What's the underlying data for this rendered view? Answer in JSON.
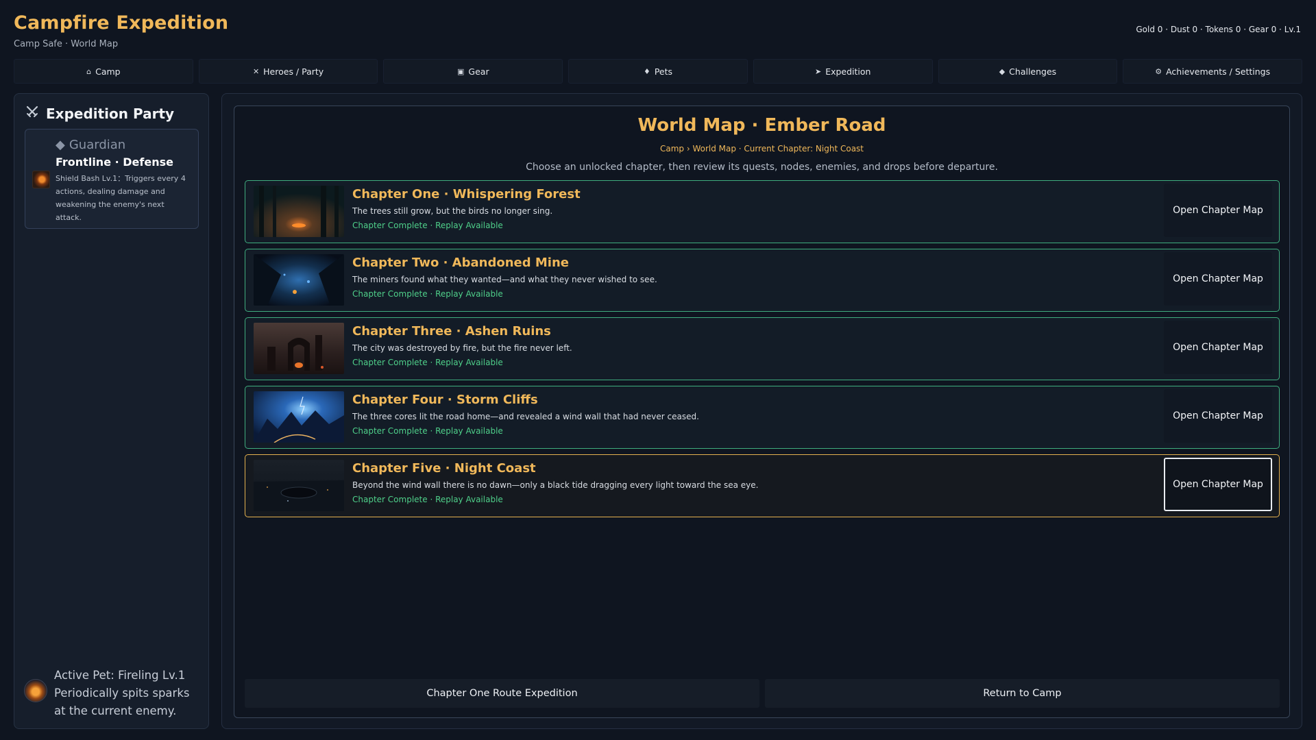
{
  "app": {
    "title": "Campfire Expedition",
    "subtitle": "Camp Safe · World Map",
    "resources": "Gold 0 · Dust 0 · Tokens 0 · Gear 0 · Lv.1"
  },
  "nav": {
    "tabs": [
      {
        "icon": "⌂",
        "label": "Camp"
      },
      {
        "icon": "✕",
        "label": "Heroes / Party"
      },
      {
        "icon": "▣",
        "label": "Gear"
      },
      {
        "icon": "♦",
        "label": "Pets"
      },
      {
        "icon": "➤",
        "label": "Expedition"
      },
      {
        "icon": "◆",
        "label": "Challenges"
      },
      {
        "icon": "⚙",
        "label": "Achievements / Settings"
      }
    ]
  },
  "party": {
    "title": "Expedition Party",
    "title_icon": "crossed-swords-icon",
    "hero": {
      "class_icon": "◆",
      "class": "Guardian",
      "role": "Frontline · Defense",
      "skill": "Shield Bash Lv.1：Triggers every 4 actions, dealing damage and weakening the enemy's next attack."
    },
    "pet": {
      "text": "Active Pet: Fireling  Lv.1 Periodically spits sparks at the current enemy."
    }
  },
  "map": {
    "title": "World Map · Ember Road",
    "breadcrumb": "Camp › World Map · Current Chapter: Night Coast",
    "description": "Choose an unlocked chapter, then review its quests, nodes, enemies, and drops before departure.",
    "chapters": [
      {
        "title": "Chapter One · Whispering Forest",
        "desc": "The trees still grow, but the birds no longer sing.",
        "status": "Chapter Complete · Replay Available",
        "button": "Open Chapter Map"
      },
      {
        "title": "Chapter Two · Abandoned Mine",
        "desc": "The miners found what they wanted—and what they never wished to see.",
        "status": "Chapter Complete · Replay Available",
        "button": "Open Chapter Map"
      },
      {
        "title": "Chapter Three · Ashen Ruins",
        "desc": "The city was destroyed by fire, but the fire never left.",
        "status": "Chapter Complete · Replay Available",
        "button": "Open Chapter Map"
      },
      {
        "title": "Chapter Four · Storm Cliffs",
        "desc": "The three cores lit the road home—and revealed a wind wall that had never ceased.",
        "status": "Chapter Complete · Replay Available",
        "button": "Open Chapter Map"
      },
      {
        "title": "Chapter Five · Night Coast",
        "desc": "Beyond the wind wall there is no dawn—only a black tide dragging every light toward the sea eye.",
        "status": "Chapter Complete · Replay Available",
        "button": "Open Chapter Map"
      }
    ],
    "bottom": {
      "route_button": "Chapter One Route Expedition",
      "return_button": "Return to Camp"
    }
  },
  "colors": {
    "accent_gold": "#f0b85a",
    "status_green": "#4fd08a",
    "complete_border": "#3fae7f",
    "current_border": "#e6b34f",
    "background": "#0f1520"
  }
}
